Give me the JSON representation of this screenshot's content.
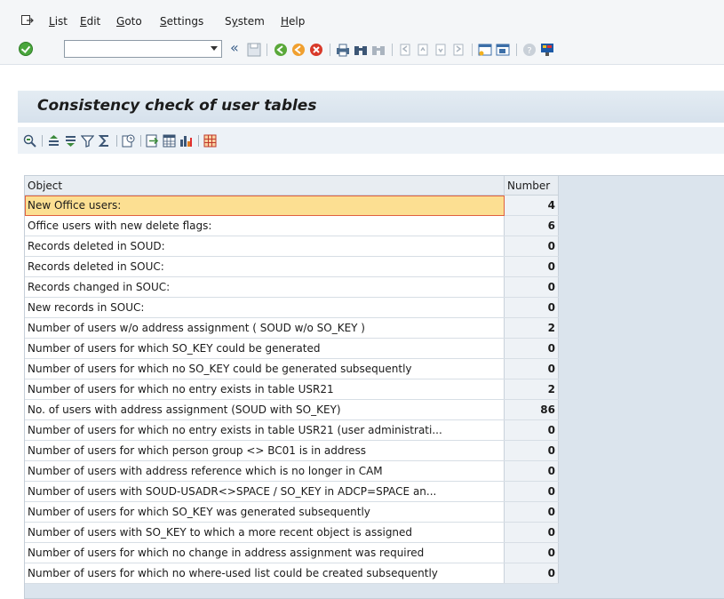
{
  "menubar": {
    "items": [
      {
        "label": "List",
        "mnemonic": "L",
        "rest": "ist"
      },
      {
        "label": "Edit",
        "mnemonic": "E",
        "rest": "dit"
      },
      {
        "label": "Goto",
        "mnemonic": "G",
        "rest": "oto"
      },
      {
        "label": "Settings",
        "mnemonic": "S",
        "rest": "ettings"
      },
      {
        "label": "System",
        "mnemonic": "y",
        "pre": "S",
        "rest": "stem"
      },
      {
        "label": "Help",
        "mnemonic": "H",
        "rest": "elp"
      }
    ]
  },
  "toolbar": {
    "command_field_value": "",
    "back_glyph": "«",
    "icons": [
      "enter-icon",
      "save-icon",
      "back-icon",
      "exit-icon",
      "cancel-icon",
      "print-icon",
      "find-icon",
      "find-next-icon",
      "first-page-icon",
      "previous-page-icon",
      "next-page-icon",
      "last-page-icon",
      "new-session-icon",
      "shortcut-icon",
      "help-icon",
      "customize-layout-icon"
    ]
  },
  "page": {
    "title": "Consistency check of user tables"
  },
  "toolbar2": {
    "icons": [
      "details-icon",
      "sort-ascending-icon",
      "sort-descending-icon",
      "filter-icon",
      "total-icon",
      "subtotal-icon",
      "export-icon",
      "spreadsheet-icon",
      "graphic-icon",
      "layout-icon"
    ]
  },
  "grid": {
    "headers": {
      "object": "Object",
      "number": "Number"
    },
    "rows": [
      {
        "object": "New Office users:",
        "number": "4"
      },
      {
        "object": "Office users with new delete flags:",
        "number": "6"
      },
      {
        "object": "Records deleted in SOUD:",
        "number": "0"
      },
      {
        "object": "Records deleted in SOUC:",
        "number": "0"
      },
      {
        "object": "Records changed in SOUC:",
        "number": "0"
      },
      {
        "object": "New records in SOUC:",
        "number": "0"
      },
      {
        "object": "Number of users w/o address assignment ( SOUD w/o SO_KEY )",
        "number": "2"
      },
      {
        "object": "Number of users for which SO_KEY could be generated",
        "number": "0"
      },
      {
        "object": "Number of users for which no SO_KEY could be generated subsequently",
        "number": "0"
      },
      {
        "object": "Number of users for which no entry exists in table USR21",
        "number": "2"
      },
      {
        "object": "No. of users with address assignment (SOUD with SO_KEY)",
        "number": "86"
      },
      {
        "object": "Number of users for which no entry exists in table USR21 (user administrati...",
        "number": "0"
      },
      {
        "object": "Number of users for which person group <> BC01 is in address",
        "number": "0"
      },
      {
        "object": "Number of users with address reference which is no longer in CAM",
        "number": "0"
      },
      {
        "object": "Number of users with SOUD-USADR<>SPACE / SO_KEY in ADCP=SPACE an...",
        "number": "0"
      },
      {
        "object": "Number of users for which SO_KEY was generated subsequently",
        "number": "0"
      },
      {
        "object": "Number of users with SO_KEY to which a more recent object is assigned",
        "number": "0"
      },
      {
        "object": "Number of users for which no change in address assignment was required",
        "number": "0"
      },
      {
        "object": "Number of users for which no where-used list could be created subsequently",
        "number": "0"
      }
    ]
  },
  "colors": {
    "selection": "#fcdf92",
    "title_bar": "#d6e1ec",
    "grid_bg": "#dbe4ed"
  }
}
